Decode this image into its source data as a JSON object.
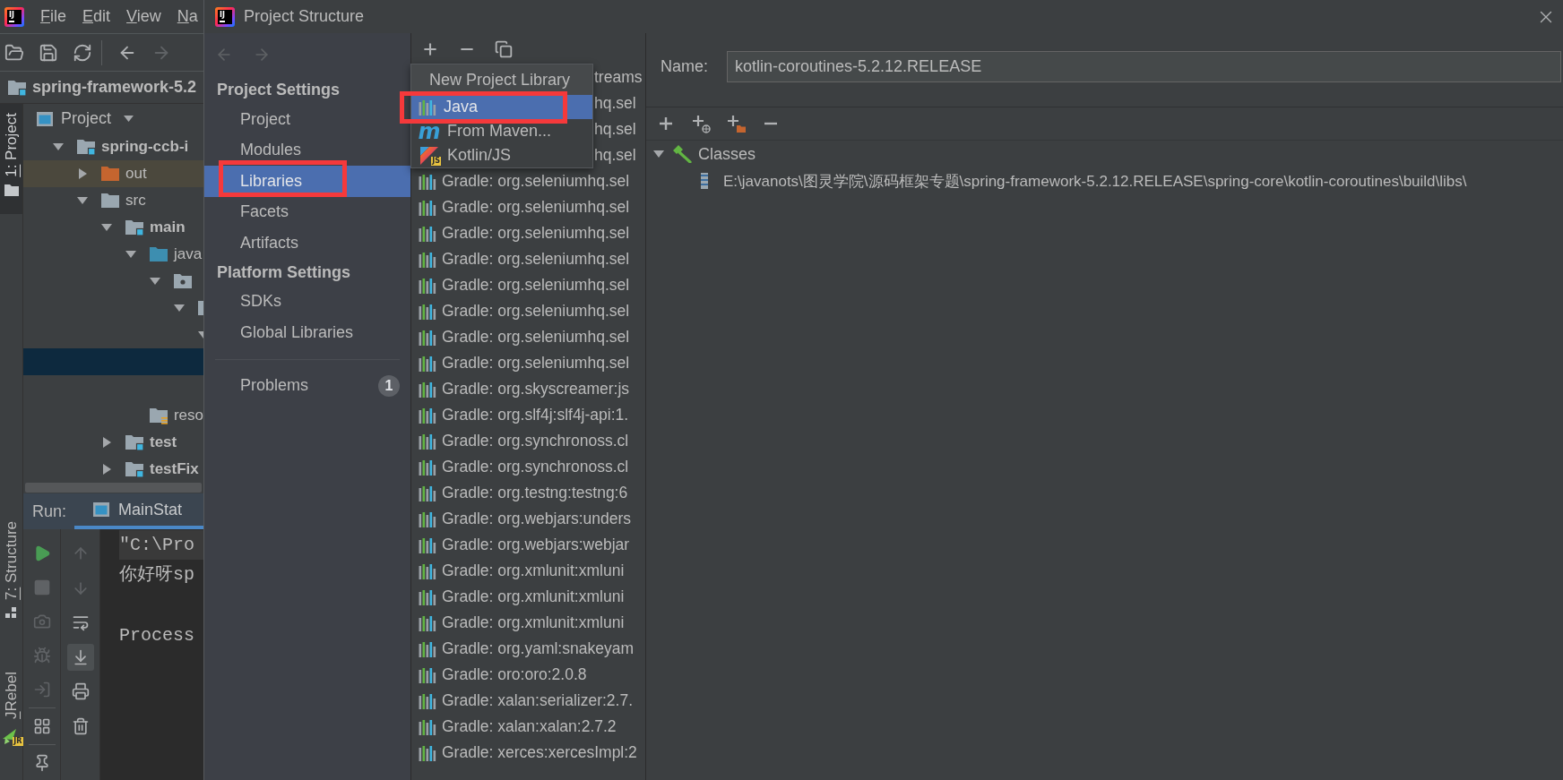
{
  "ide": {
    "logo": "IJ",
    "menu": [
      "File",
      "Edit",
      "View",
      "Na"
    ],
    "toolbar": [
      [
        {
          "kind": "open",
          "disabled": false
        },
        {
          "kind": "save",
          "disabled": false
        },
        {
          "kind": "sync",
          "disabled": false
        }
      ],
      [
        {
          "kind": "back",
          "disabled": false
        },
        {
          "kind": "forward",
          "disabled": true
        }
      ]
    ],
    "breadcrumb": "spring-framework-5.2",
    "left_stripe": {
      "top": [
        {
          "label": "1: Project",
          "kind": "project",
          "selected": true
        }
      ],
      "bottom": [
        {
          "label": "7: Structure",
          "kind": "structure",
          "selected": false
        },
        {
          "label": "JRebel",
          "kind": "jrebel",
          "badge": "JR",
          "selected": false
        }
      ]
    },
    "project_view": {
      "title": "Project",
      "tree": [
        {
          "label": "spring-ccb-i",
          "kind": "module",
          "expanded": true,
          "selected": false,
          "children": [
            {
              "label": "out",
              "kind": "excluded",
              "expanded": false,
              "selected": false
            },
            {
              "label": "src",
              "kind": "folder",
              "expanded": true,
              "selected": false,
              "children": [
                {
                  "label": "main",
                  "kind": "module",
                  "expanded": true,
                  "selected": false,
                  "children": [
                    {
                      "label": "java",
                      "kind": "source",
                      "expanded": true,
                      "selected": false,
                      "children": [
                        {
                          "kind": "package",
                          "expanded": true,
                          "selected": false,
                          "children": [
                            {
                              "kind": "package",
                              "expanded": true,
                              "selected": false,
                              "children": [
                                {
                                  "expanded": true,
                                  "selected": false,
                                  "children": [
                                    {
                                      "selected": true
                                    },
                                    {
                                      "selected": false
                                    }
                                  ]
                                }
                              ]
                            }
                          ]
                        }
                      ]
                    },
                    {
                      "label": "reso",
                      "kind": "resources",
                      "selected": false
                    }
                  ]
                },
                {
                  "label": "test",
                  "kind": "module",
                  "expanded": false,
                  "selected": false
                },
                {
                  "label": "testFix",
                  "kind": "module",
                  "expanded": false,
                  "selected": false
                }
              ]
            }
          ]
        }
      ]
    },
    "run_view": {
      "label": "Run:",
      "tabs": [
        {
          "label": "MainStat",
          "selected": true
        }
      ],
      "toolbar_left": [
        [
          {
            "kind": "rerun",
            "disabled": false
          },
          {
            "kind": "stop",
            "disabled": true
          },
          {
            "kind": "dump",
            "disabled": true
          },
          {
            "kind": "debug",
            "disabled": true
          },
          {
            "kind": "exit",
            "disabled": true
          }
        ],
        [
          {
            "kind": "layout",
            "disabled": false
          }
        ],
        [
          {
            "kind": "pin",
            "disabled": false
          }
        ]
      ],
      "toolbar_right": [
        {
          "kind": "up",
          "disabled": true,
          "on": false
        },
        {
          "kind": "down",
          "disabled": true,
          "on": false
        },
        {
          "kind": "wrap",
          "disabled": false,
          "on": false
        },
        {
          "kind": "scroll_end",
          "disabled": false,
          "on": true
        },
        {
          "kind": "print",
          "disabled": false,
          "on": false
        },
        {
          "kind": "trash",
          "disabled": false,
          "on": false
        }
      ],
      "console": [
        {
          "kind": "command",
          "text": "\"C:\\Pro",
          "current": true
        },
        {
          "kind": "output",
          "text": "你好呀sp",
          "current": false
        },
        {
          "kind": "exit",
          "text": "Process",
          "current": false
        }
      ]
    }
  },
  "dialog": {
    "logo": "IJ",
    "title": "Project Structure",
    "history": [
      {
        "kind": "back",
        "disabled": true
      },
      {
        "kind": "forward",
        "disabled": true
      }
    ],
    "sidebar": {
      "sections": [
        {
          "heading": "Project Settings",
          "items": [
            {
              "label": "Project",
              "selected": false,
              "marked": false
            },
            {
              "label": "Modules",
              "selected": false,
              "marked": false
            },
            {
              "label": "Libraries",
              "selected": true,
              "marked": true
            },
            {
              "label": "Facets",
              "selected": false,
              "marked": false
            },
            {
              "label": "Artifacts",
              "selected": false,
              "marked": false
            }
          ]
        },
        {
          "heading": "Platform Settings",
          "items": [
            {
              "label": "SDKs",
              "selected": false,
              "marked": false
            },
            {
              "label": "Global Libraries",
              "selected": false,
              "marked": false
            }
          ]
        }
      ],
      "problems": {
        "label": "Problems",
        "count": "1"
      }
    },
    "libraries": [
      {
        "kind": "covered",
        "text": "treams"
      },
      {
        "kind": "covered",
        "text": "hq.sel"
      },
      {
        "kind": "covered",
        "text": "hq.sel"
      },
      {
        "kind": "covered",
        "text": "hq.sel"
      },
      {
        "kind": "library",
        "text": "Gradle: org.seleniumhq.sel"
      },
      {
        "kind": "library",
        "text": "Gradle: org.seleniumhq.sel"
      },
      {
        "kind": "library",
        "text": "Gradle: org.seleniumhq.sel"
      },
      {
        "kind": "library",
        "text": "Gradle: org.seleniumhq.sel"
      },
      {
        "kind": "library",
        "text": "Gradle: org.seleniumhq.sel"
      },
      {
        "kind": "library",
        "text": "Gradle: org.seleniumhq.sel"
      },
      {
        "kind": "library",
        "text": "Gradle: org.seleniumhq.sel"
      },
      {
        "kind": "library",
        "text": "Gradle: org.seleniumhq.sel"
      },
      {
        "kind": "library",
        "text": "Gradle: org.skyscreamer:js"
      },
      {
        "kind": "library",
        "text": "Gradle: org.slf4j:slf4j-api:1."
      },
      {
        "kind": "library",
        "text": "Gradle: org.synchronoss.cl"
      },
      {
        "kind": "library",
        "text": "Gradle: org.synchronoss.cl"
      },
      {
        "kind": "library",
        "text": "Gradle: org.testng:testng:6"
      },
      {
        "kind": "library",
        "text": "Gradle: org.webjars:unders"
      },
      {
        "kind": "library",
        "text": "Gradle: org.webjars:webjar"
      },
      {
        "kind": "library",
        "text": "Gradle: org.xmlunit:xmluni"
      },
      {
        "kind": "library",
        "text": "Gradle: org.xmlunit:xmluni"
      },
      {
        "kind": "library",
        "text": "Gradle: org.xmlunit:xmluni"
      },
      {
        "kind": "library",
        "text": "Gradle: org.yaml:snakeyam"
      },
      {
        "kind": "library",
        "text": "Gradle: oro:oro:2.0.8"
      },
      {
        "kind": "library",
        "text": "Gradle: xalan:serializer:2.7."
      },
      {
        "kind": "library",
        "text": "Gradle: xalan:xalan:2.7.2"
      },
      {
        "kind": "library",
        "text": "Gradle: xerces:xercesImpl:2"
      }
    ],
    "new_library_menu": {
      "title": "New Project Library",
      "items": [
        {
          "kind": "java",
          "label": "Java",
          "selected": true,
          "marked": true
        },
        {
          "kind": "maven",
          "label": "From Maven...",
          "icon_text": "m",
          "selected": false,
          "marked": false
        },
        {
          "kind": "kotlin_js",
          "label": "Kotlin/JS",
          "icon_text": "JS",
          "selected": false,
          "marked": false
        }
      ]
    },
    "name_field": {
      "label": "Name:",
      "value": "kotlin-coroutines-5.2.12.RELEASE"
    },
    "roots": [
      {
        "label": "Classes",
        "kind": "classes",
        "expanded": true,
        "children": [
          {
            "label": "E:\\javanots\\图灵学院\\源码框架专题\\spring-framework-5.2.12.RELEASE\\spring-core\\kotlin-coroutines\\build\\libs\\",
            "kind": "jar"
          }
        ]
      }
    ]
  }
}
